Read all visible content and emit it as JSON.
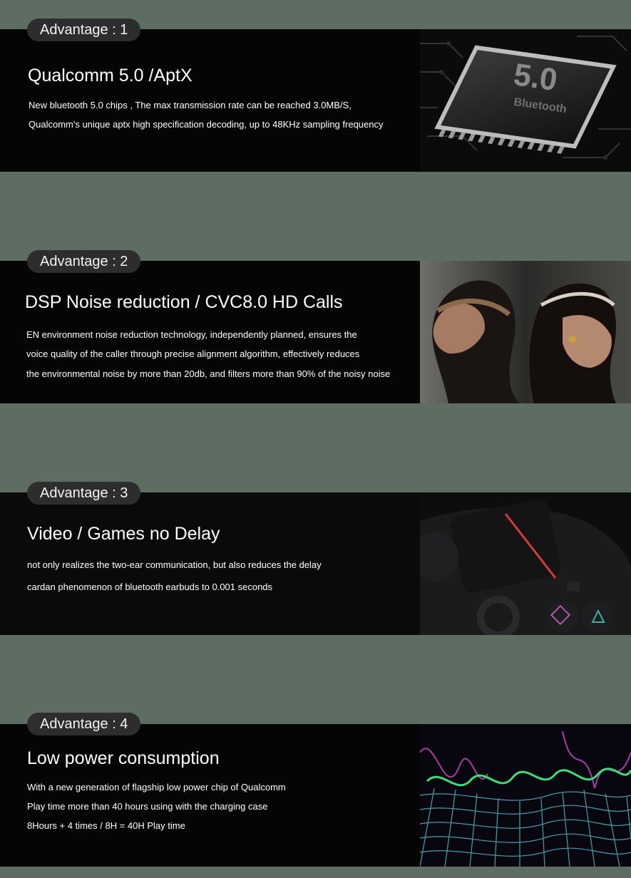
{
  "sections": [
    {
      "badge": "Advantage : 1",
      "title": "Qualcomm 5.0 /AptX",
      "lines": [
        "New bluetooth 5.0 chips , The max transmission rate can be reached 3.0MB/S,",
        "Qualcomm's unique aptx high specification decoding, up to 48KHz sampling frequency"
      ],
      "image": {
        "icon": "bluetooth-chip-image",
        "chip_text": "5.0",
        "chip_subtext": "Bluetooth"
      }
    },
    {
      "badge": "Advantage : 2",
      "title": "DSP Noise reduction / CVC8.0 HD Calls",
      "lines": [
        "EN environment noise reduction technology, independently planned, ensures the",
        "voice quality of the caller through precise alignment algorithm, effectively reduces",
        "the environmental noise by more than 20db, and filters more than 90% of the noisy noise"
      ],
      "image": {
        "icon": "two-women-earbuds-image"
      }
    },
    {
      "badge": "Advantage : 3",
      "title": "Video / Games no Delay",
      "lines": [
        "not only realizes the two-ear communication, but also reduces the delay",
        "cardan phenomenon of bluetooth earbuds to 0.001 seconds"
      ],
      "image": {
        "icon": "game-controller-image"
      }
    },
    {
      "badge": "Advantage : 4",
      "title": "Low power consumption",
      "lines": [
        "With a new generation of flagship low power chip of Qualcomm",
        "Play time more than 40 hours using with the charging case",
        "8Hours + 4 times / 8H = 40H Play time"
      ],
      "image": {
        "icon": "sound-wave-grid-image"
      }
    }
  ],
  "colors": {
    "background": "#5e6d61",
    "band": "#050505",
    "badge": "#2d2d2d"
  }
}
